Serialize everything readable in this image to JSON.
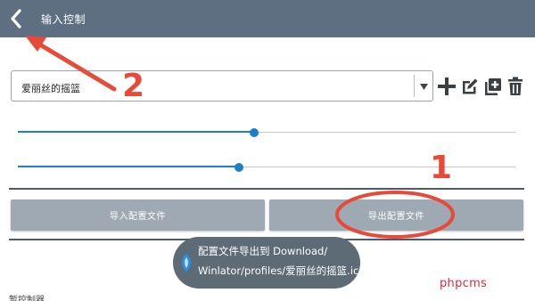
{
  "header": {
    "title": "输入控制",
    "back_icon": "chevron-left-icon",
    "background": "#5d6f80"
  },
  "profile": {
    "selected": "爱丽丝的摇篮",
    "actions": [
      {
        "name": "add-profile-button",
        "icon": "plus-icon"
      },
      {
        "name": "edit-profile-button",
        "icon": "edit-icon"
      },
      {
        "name": "duplicate-profile-button",
        "icon": "copy-icon"
      },
      {
        "name": "delete-profile-button",
        "icon": "trash-icon"
      }
    ]
  },
  "sliders": [
    {
      "name": "slider-1",
      "value": 0.475
    },
    {
      "name": "slider-2",
      "value": 0.445
    }
  ],
  "buttons": {
    "import_label": "导入配置文件",
    "export_label": "导出配置文件"
  },
  "toast": {
    "line1": "配置文件导出到 Download/",
    "line2": "Winlator/profiles/爱丽丝的摇篮.icp"
  },
  "section_label": "暂控制器",
  "watermark": "phpcms",
  "annotations": [
    {
      "label": "1",
      "color": "#e84a3a"
    },
    {
      "label": "2",
      "color": "#e84a3a"
    }
  ],
  "colors": {
    "accent": "#1d7ec9",
    "button": "#9ea9b3",
    "annotation": "#e84a3a",
    "watermark": "#e0283a"
  }
}
